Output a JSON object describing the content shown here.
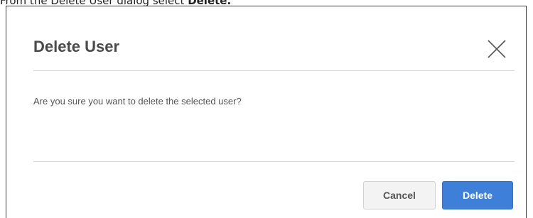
{
  "instruction": {
    "prefix": "From the Delete User dialog select ",
    "action": "Delete."
  },
  "dialog": {
    "title": "Delete User",
    "message": "Are you sure you want to delete the selected user?",
    "cancel_label": "Cancel",
    "delete_label": "Delete",
    "close_icon": "close-icon"
  },
  "colors": {
    "primary": "#3d7fd9",
    "title_text": "#4a4a4a",
    "divider": "#d9d9d9"
  }
}
